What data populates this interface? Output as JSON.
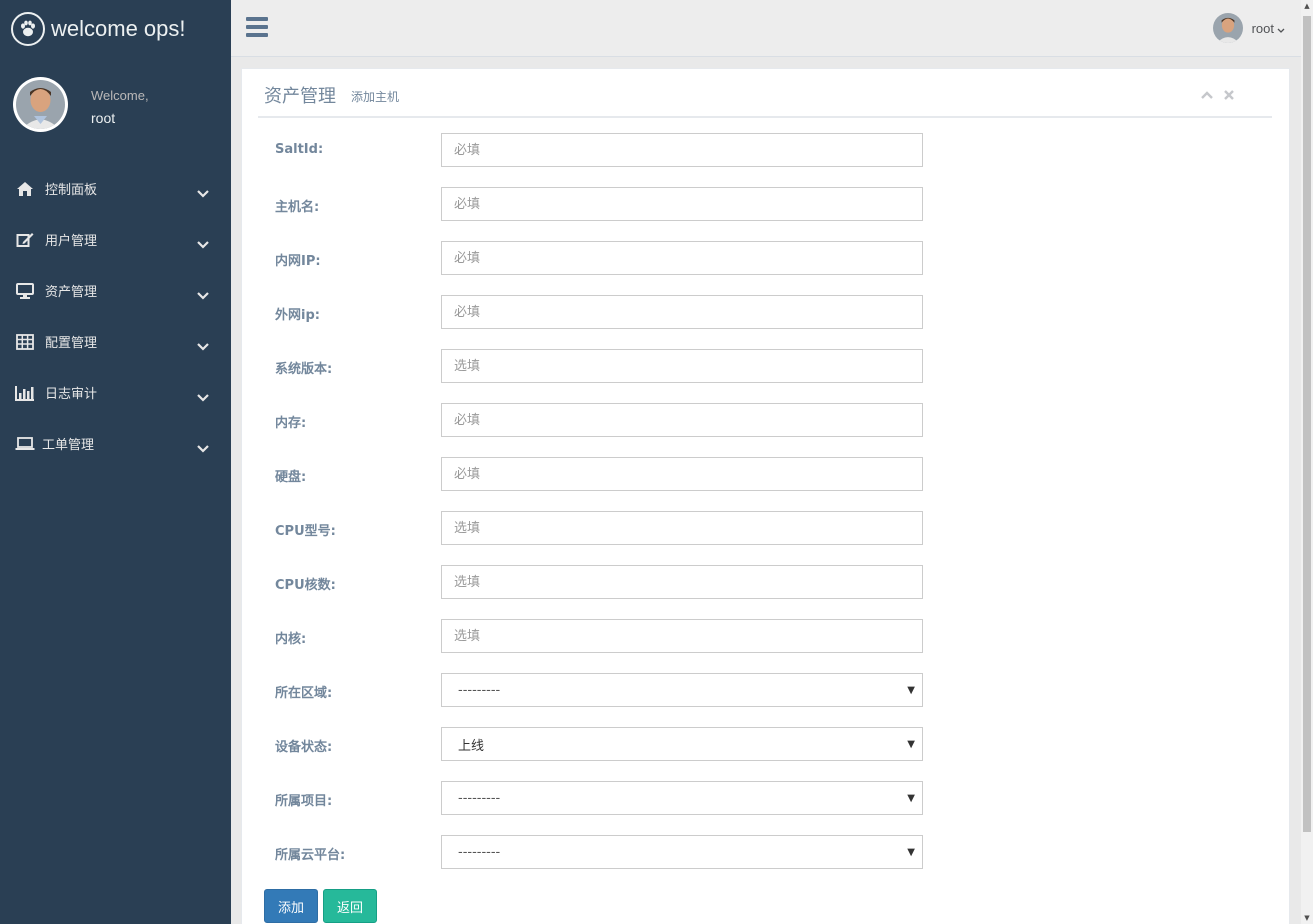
{
  "brand": {
    "title": "welcome ops!"
  },
  "profile": {
    "welcome": "Welcome,",
    "username": "root"
  },
  "sidebar": {
    "items": [
      {
        "label": "控制面板",
        "icon": "home-icon"
      },
      {
        "label": "用户管理",
        "icon": "edit-icon"
      },
      {
        "label": "资产管理",
        "icon": "desktop-icon"
      },
      {
        "label": "配置管理",
        "icon": "table-icon"
      },
      {
        "label": "日志审计",
        "icon": "bar-chart-icon"
      },
      {
        "label": "工单管理",
        "icon": "laptop-icon"
      }
    ]
  },
  "topnav": {
    "username": "root"
  },
  "panel": {
    "title": "资产管理",
    "subtitle": "添加主机"
  },
  "form": {
    "fields": [
      {
        "label": "SaltId:",
        "placeholder": "必填"
      },
      {
        "label": "主机名:",
        "placeholder": "必填"
      },
      {
        "label": "内网IP:",
        "placeholder": "必填"
      },
      {
        "label": "外网ip:",
        "placeholder": "必填"
      },
      {
        "label": "系统版本:",
        "placeholder": "选填"
      },
      {
        "label": "内存:",
        "placeholder": "必填"
      },
      {
        "label": "硬盘:",
        "placeholder": "必填"
      },
      {
        "label": "CPU型号:",
        "placeholder": "选填"
      },
      {
        "label": "CPU核数:",
        "placeholder": "选填"
      },
      {
        "label": "内核:",
        "placeholder": "选填"
      }
    ],
    "selects": [
      {
        "label": "所在区域:",
        "value": "---------"
      },
      {
        "label": "设备状态:",
        "value": "上线"
      },
      {
        "label": "所属项目:",
        "value": "---------"
      },
      {
        "label": "所属云平台:",
        "value": "---------"
      }
    ],
    "add_label": "添加",
    "back_label": "返回"
  },
  "colors": {
    "sidebar": "#2a3f54",
    "primary": "#337ab7",
    "success": "#26b99a"
  }
}
